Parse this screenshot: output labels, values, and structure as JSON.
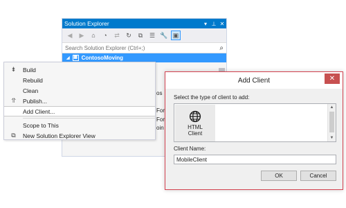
{
  "solution_explorer": {
    "title": "Solution Explorer",
    "title_controls": [
      "▾",
      "⊥",
      "✕"
    ],
    "search_placeholder": "Search Solution Explorer (Ctrl+;)",
    "project_name": "ContosoMoving",
    "fragments": [
      "os",
      "Fort",
      "Fort",
      "oin"
    ]
  },
  "context_menu": {
    "items": [
      {
        "label": "Build",
        "icon": "build-icon"
      },
      {
        "label": "Rebuild",
        "icon": ""
      },
      {
        "label": "Clean",
        "icon": ""
      },
      {
        "label": "Publish...",
        "icon": "publish-icon"
      },
      {
        "label": "Add Client...",
        "icon": "",
        "highlighted": true
      },
      {
        "label": "Scope to This",
        "icon": ""
      },
      {
        "label": "New Solution Explorer View",
        "icon": "new-view-icon"
      }
    ]
  },
  "dialog": {
    "title": "Add Client",
    "close_glyph": "✕",
    "prompt": "Select the type of client to add:",
    "client_types": [
      {
        "label": "HTML Client",
        "icon": "globe-icon"
      }
    ],
    "name_label": "Client Name:",
    "name_value": "MobileClient",
    "ok_label": "OK",
    "cancel_label": "Cancel"
  },
  "colors": {
    "accent": "#007acc",
    "selection": "#3399ff",
    "dialog_border": "#d3414f",
    "close_button": "#c75050"
  }
}
